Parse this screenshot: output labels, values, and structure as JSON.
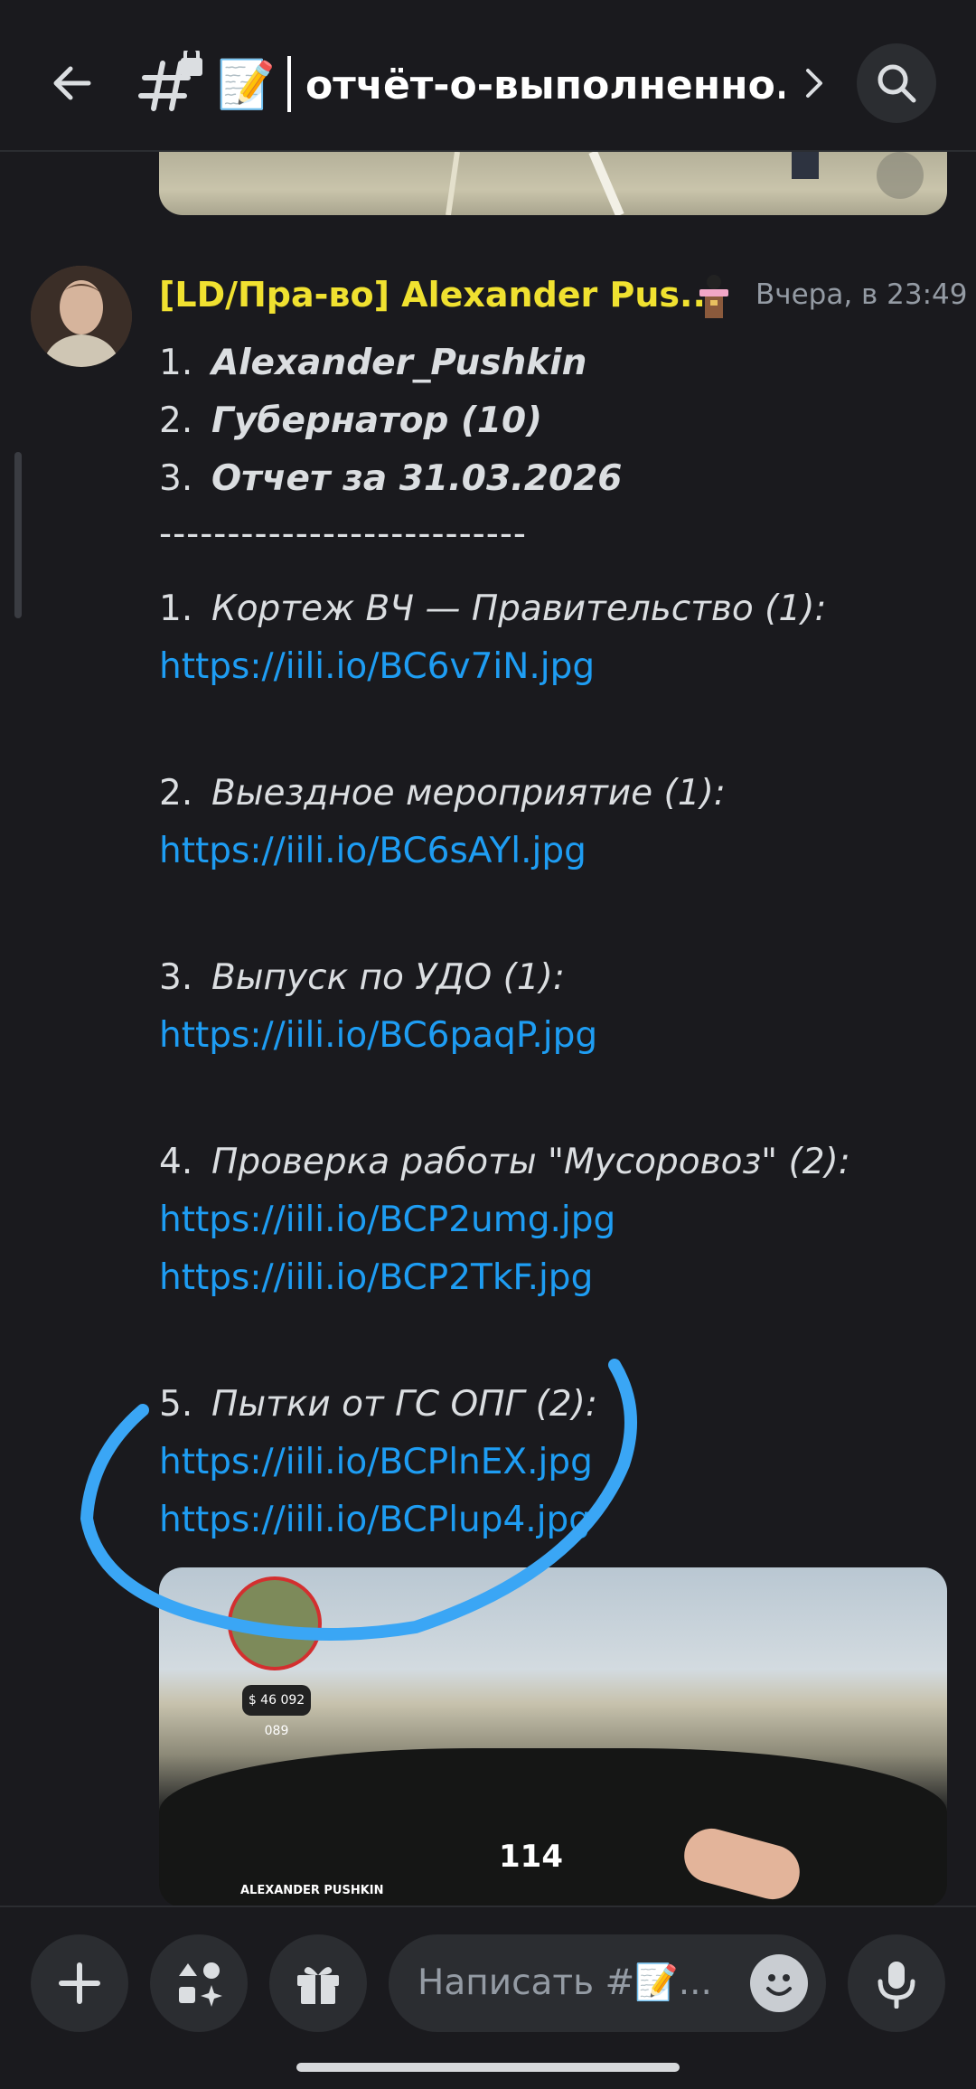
{
  "header": {
    "back_icon": "arrow-left-icon",
    "channel_icon": "locked-hash-icon",
    "memo_emoji": "📝",
    "title": "отчёт-о-выполненно...",
    "chevron_icon": "chevron-right-icon",
    "search_icon": "search-icon"
  },
  "message": {
    "username": "[LD/Пра-во] Alexander Pus...",
    "role_icon": "podium-badge-icon",
    "timestamp": "Вчера, в 23:49",
    "colors": {
      "username": "#f0e130",
      "link": "#1e9df3"
    },
    "header_list": [
      {
        "n": "1.",
        "text": "Alexander_Pushkin"
      },
      {
        "n": "2.",
        "text": "Губернатор (10)"
      },
      {
        "n": "3.",
        "text": "Отчет за 31.03.2026"
      }
    ],
    "divider": "---------------------------",
    "reports": [
      {
        "n": "1.",
        "title": "Кортеж ВЧ — Правительство (1):",
        "links": [
          "https://iili.io/BC6v7iN.jpg"
        ]
      },
      {
        "n": "2.",
        "title": "Выездное мероприятие (1):",
        "links": [
          "https://iili.io/BC6sAYl.jpg"
        ]
      },
      {
        "n": "3.",
        "title": "Выпуск по УДО (1):",
        "links": [
          "https://iili.io/BC6paqP.jpg"
        ]
      },
      {
        "n": "4.",
        "title": "Проверка работы \"Мусоровоз\" (2):",
        "links": [
          "https://iili.io/BCP2umg.jpg",
          "https://iili.io/BCP2TkF.jpg"
        ]
      },
      {
        "n": "5.",
        "title": "Пытки от ГС ОПГ (2):",
        "links": [
          "https://iili.io/BCPlnEX.jpg",
          "https://iili.io/BCPlup4.jpg"
        ]
      }
    ],
    "attachment": {
      "speed": "114",
      "money": "$ 46 092 089",
      "player_name": "ALEXANDER PUSHKIN"
    }
  },
  "composer": {
    "add_icon": "plus-icon",
    "apps_icon": "apps-sparkle-icon",
    "gift_icon": "gift-icon",
    "placeholder": "Написать #📝...",
    "emoji_icon": "smiley-emoji-icon",
    "mic_icon": "microphone-icon"
  }
}
